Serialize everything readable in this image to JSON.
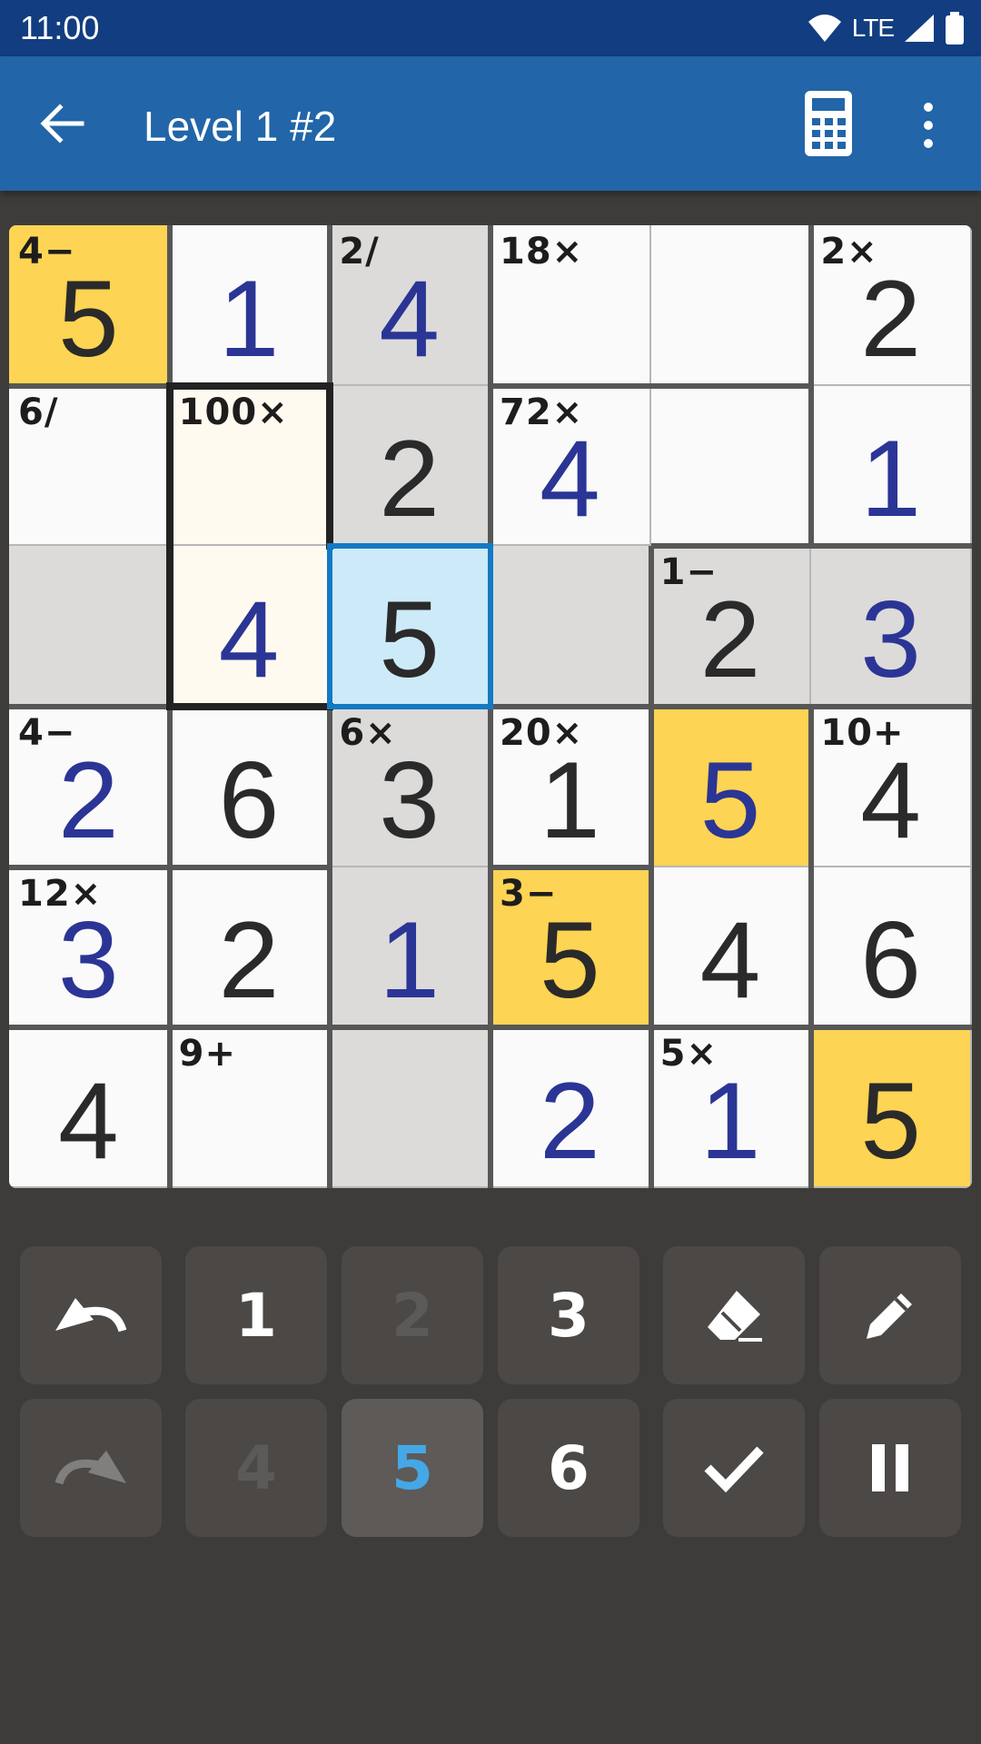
{
  "status": {
    "time": "11:00",
    "network": "LTE"
  },
  "header": {
    "title": "Level 1 #2"
  },
  "cage_labels": {
    "r0c0": "4−",
    "r0c2": "2/",
    "r0c3": "18×",
    "r0c5": "2×",
    "r1c0": "6/",
    "r1c1": "100×",
    "r1c3": "72×",
    "r2c4": "1−",
    "r3c0": "4−",
    "r3c2": "6×",
    "r3c3": "20×",
    "r3c5": "10+",
    "r4c0": "12×",
    "r4c3": "3−",
    "r5c1": "9+",
    "r5c4": "5×"
  },
  "cell_values": {
    "r0c0": "5",
    "r0c1": "1",
    "r0c2": "4",
    "r0c5": "2",
    "r1c2": "2",
    "r1c3": "4",
    "r1c5": "1",
    "r2c1": "4",
    "r2c2": "5",
    "r2c4": "2",
    "r2c5": "3",
    "r3c0": "2",
    "r3c1": "6",
    "r3c2": "3",
    "r3c3": "1",
    "r3c4": "5",
    "r3c5": "4",
    "r4c0": "3",
    "r4c1": "2",
    "r4c2": "1",
    "r4c3": "5",
    "r4c4": "4",
    "r4c5": "6",
    "r5c0": "4",
    "r5c3": "2",
    "r5c4": "1",
    "r5c5": "5"
  },
  "keypad": {
    "row1": [
      "undo-icon",
      "1",
      "2",
      "3",
      "eraser-icon",
      "pencil-icon"
    ],
    "row2": [
      "redo-icon",
      "4",
      "5",
      "6",
      "check-icon",
      "pause-icon"
    ],
    "selected_number": "5",
    "disabled_numbers": [
      "2",
      "4"
    ]
  },
  "colors": {
    "statusbar": "#123d80",
    "appbar": "#2265a8",
    "background": "#3e3c3a",
    "highlight_yellow": "#fdd453",
    "selected_cell": "#cdeaf8",
    "entered_digit": "#2b3595",
    "given_digit": "#2a2a2a",
    "selected_key": "#45a7e6"
  }
}
